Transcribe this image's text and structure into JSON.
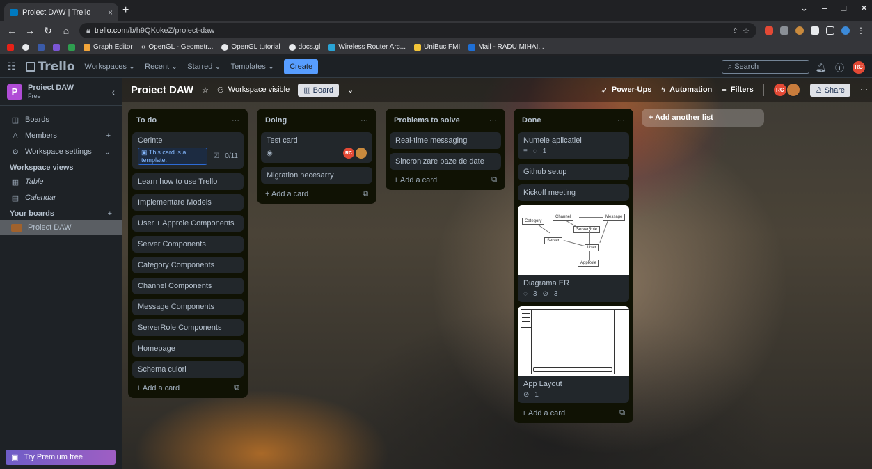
{
  "browser": {
    "tab_title": "Proiect DAW | Trello",
    "tab_close": "×",
    "new_tab": "+",
    "url_domain": "trello.com",
    "url_path": "/b/h9QKokeZ/proiect-daw",
    "bookmarks": [
      "Graph Editor",
      "OpenGL - Geometr...",
      "OpenGL tutorial",
      "docs.gl",
      "Wireless Router Arc...",
      "UniBuc FMI",
      "Mail - RADU MIHAI..."
    ]
  },
  "header": {
    "logo": "Trello",
    "nav": [
      "Workspaces ⌄",
      "Recent ⌄",
      "Starred ⌄",
      "Templates ⌄"
    ],
    "create": "Create",
    "search_placeholder": "Search",
    "avatar": "RC"
  },
  "sidebar": {
    "workspace_initial": "P",
    "workspace_name": "Proiect DAW",
    "workspace_plan": "Free",
    "items": [
      {
        "label": "Boards",
        "icon": "board-icon"
      },
      {
        "label": "Members",
        "icon": "members-icon",
        "extra": "+"
      },
      {
        "label": "Workspace settings",
        "icon": "settings-icon",
        "extra": "⌄"
      }
    ],
    "views_title": "Workspace views",
    "views": [
      {
        "label": "Table",
        "icon": "table-icon"
      },
      {
        "label": "Calendar",
        "icon": "calendar-icon"
      }
    ],
    "your_boards_title": "Your boards",
    "your_boards_add": "+",
    "boards": [
      "Proiect DAW"
    ],
    "premium": "Try Premium free"
  },
  "board": {
    "title": "Proiect DAW",
    "visibility": "Workspace visible",
    "view": "Board",
    "power_ups": "Power-Ups",
    "automation": "Automation",
    "filters": "Filters",
    "share": "Share",
    "add_list": "+ Add another list",
    "add_card": "+ Add a card",
    "lists": [
      {
        "title": "To do",
        "cards": [
          {
            "title": "Cerinte",
            "template": "This card is a template.",
            "checklist": "0/11"
          },
          {
            "title": "Learn how to use Trello"
          },
          {
            "title": "Implementare Models"
          },
          {
            "title": "User + Approle Components"
          },
          {
            "title": "Server Components"
          },
          {
            "title": "Category Components"
          },
          {
            "title": "Channel Components"
          },
          {
            "title": "Message Components"
          },
          {
            "title": "ServerRole Components"
          },
          {
            "title": "Homepage"
          },
          {
            "title": "Schema culori"
          }
        ]
      },
      {
        "title": "Doing",
        "cards": [
          {
            "title": "Test card",
            "member": "RC"
          },
          {
            "title": "Migration necesarry"
          }
        ]
      },
      {
        "title": "Problems to solve",
        "cards": [
          {
            "title": "Real-time messaging"
          },
          {
            "title": "Sincronizare baze de date"
          }
        ]
      },
      {
        "title": "Done",
        "cards": [
          {
            "title": "Numele aplicatiei",
            "comments": "1"
          },
          {
            "title": "Github setup"
          },
          {
            "title": "Kickoff meeting"
          },
          {
            "title": "Diagrama ER",
            "comments": "3",
            "attachments": "3"
          },
          {
            "title": "App Layout",
            "attachments": "1"
          }
        ]
      }
    ],
    "er_entities": [
      "Category",
      "Channel",
      "Message",
      "ServerRole",
      "Server",
      "User",
      "AppRole"
    ]
  }
}
